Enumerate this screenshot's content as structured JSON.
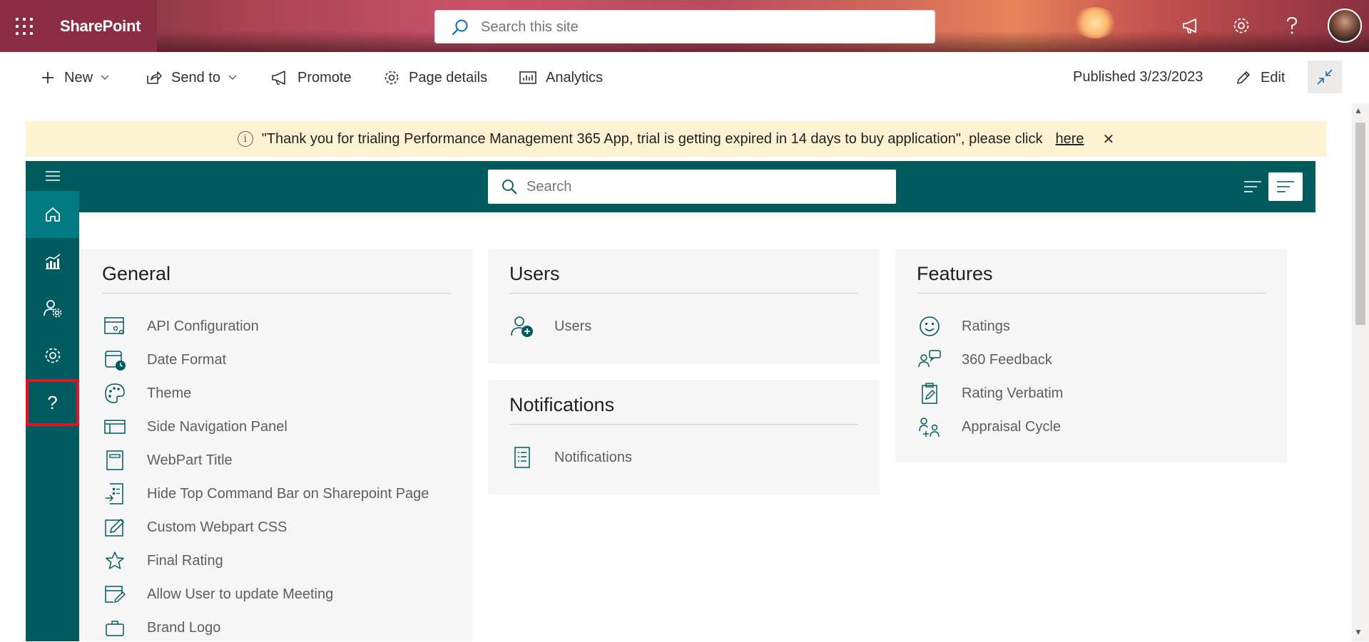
{
  "suite_bar": {
    "app_name": "SharePoint",
    "search_placeholder": "Search this site",
    "icons": [
      "waffle-icon",
      "megaphone-icon",
      "gear-icon",
      "help-icon",
      "avatar"
    ]
  },
  "command_bar": {
    "new_label": "New",
    "send_to_label": "Send to",
    "promote_label": "Promote",
    "page_details_label": "Page details",
    "analytics_label": "Analytics",
    "published_label": "Published 3/23/2023",
    "edit_label": "Edit"
  },
  "banner": {
    "info_glyph": "i",
    "message": "\"Thank you for trialing Performance Management 365 App, trial is getting expired in 14 days to buy application\", please click",
    "link_text": "here",
    "close_glyph": "✕"
  },
  "app": {
    "search_placeholder": "Search",
    "left_nav": [
      "menu-icon",
      "home-icon",
      "analytics-icon",
      "user-settings-icon",
      "gear-icon",
      "help-icon"
    ],
    "help_glyph": "?",
    "accent": "#005a5e"
  },
  "cards": {
    "general": {
      "title": "General",
      "items": [
        {
          "label": "API Configuration",
          "icon": "api-config-icon"
        },
        {
          "label": "Date Format",
          "icon": "calendar-clock-icon"
        },
        {
          "label": "Theme",
          "icon": "palette-icon"
        },
        {
          "label": "Side Navigation Panel",
          "icon": "side-panel-icon"
        },
        {
          "label": "WebPart Title",
          "icon": "webpart-title-icon"
        },
        {
          "label": "Hide Top Command Bar on Sharepoint Page",
          "icon": "command-bar-icon"
        },
        {
          "label": "Custom Webpart CSS",
          "icon": "edit-css-icon"
        },
        {
          "label": "Final Rating",
          "icon": "star-icon"
        },
        {
          "label": "Allow User to update Meeting",
          "icon": "edit-window-icon"
        },
        {
          "label": "Brand Logo",
          "icon": "briefcase-icon"
        }
      ]
    },
    "users": {
      "title": "Users",
      "items": [
        {
          "label": "Users",
          "icon": "add-user-icon"
        }
      ]
    },
    "notifications": {
      "title": "Notifications",
      "items": [
        {
          "label": "Notifications",
          "icon": "document-list-icon"
        }
      ]
    },
    "features": {
      "title": "Features",
      "items": [
        {
          "label": "Ratings",
          "icon": "smiley-icon"
        },
        {
          "label": "360 Feedback",
          "icon": "feedback-icon"
        },
        {
          "label": "Rating Verbatim",
          "icon": "clipboard-edit-icon"
        },
        {
          "label": "Appraisal Cycle",
          "icon": "appraisal-icon"
        }
      ]
    }
  }
}
